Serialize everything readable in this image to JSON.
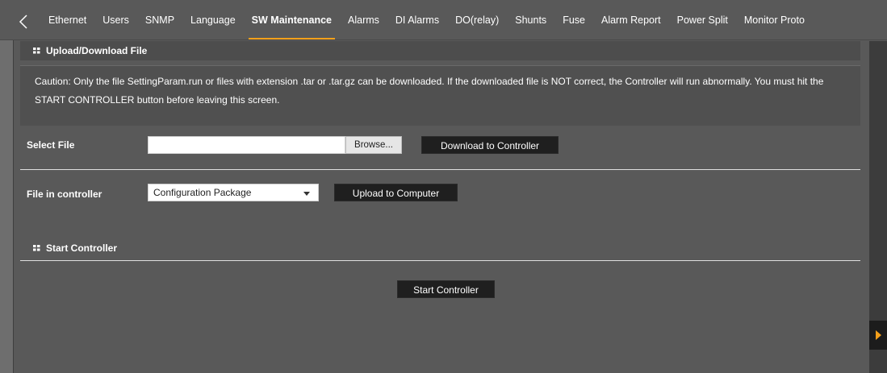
{
  "tabs": [
    {
      "label": "Ethernet"
    },
    {
      "label": "Users"
    },
    {
      "label": "SNMP"
    },
    {
      "label": "Language"
    },
    {
      "label": "SW Maintenance",
      "active": true
    },
    {
      "label": "Alarms"
    },
    {
      "label": "DI Alarms"
    },
    {
      "label": "DO(relay)"
    },
    {
      "label": "Shunts"
    },
    {
      "label": "Fuse"
    },
    {
      "label": "Alarm Report"
    },
    {
      "label": "Power Split"
    },
    {
      "label": "Monitor Proto"
    }
  ],
  "upload_section": {
    "title": "Upload/Download File",
    "caution": "Caution: Only the file SettingParam.run or files with extension .tar or .tar.gz can be downloaded. If the downloaded file is NOT correct, the Controller will run abnormally. You must hit the START CONTROLLER button before leaving this screen.",
    "select_file_label": "Select File",
    "file_value": "",
    "browse_label": "Browse...",
    "download_button": "Download to Controller",
    "file_in_controller_label": "File in controller",
    "file_select_value": "Configuration Package",
    "upload_button": "Upload to Computer"
  },
  "start_section": {
    "title": "Start Controller",
    "start_button": "Start Controller"
  },
  "colors": {
    "accent": "#f5a01a",
    "background": "#595959",
    "header": "#4d4d4d",
    "button": "#1f1f1f"
  },
  "icons": {
    "back": "chevron-left-icon",
    "section": "grid-icon",
    "scroll": "triangle-right-icon"
  }
}
